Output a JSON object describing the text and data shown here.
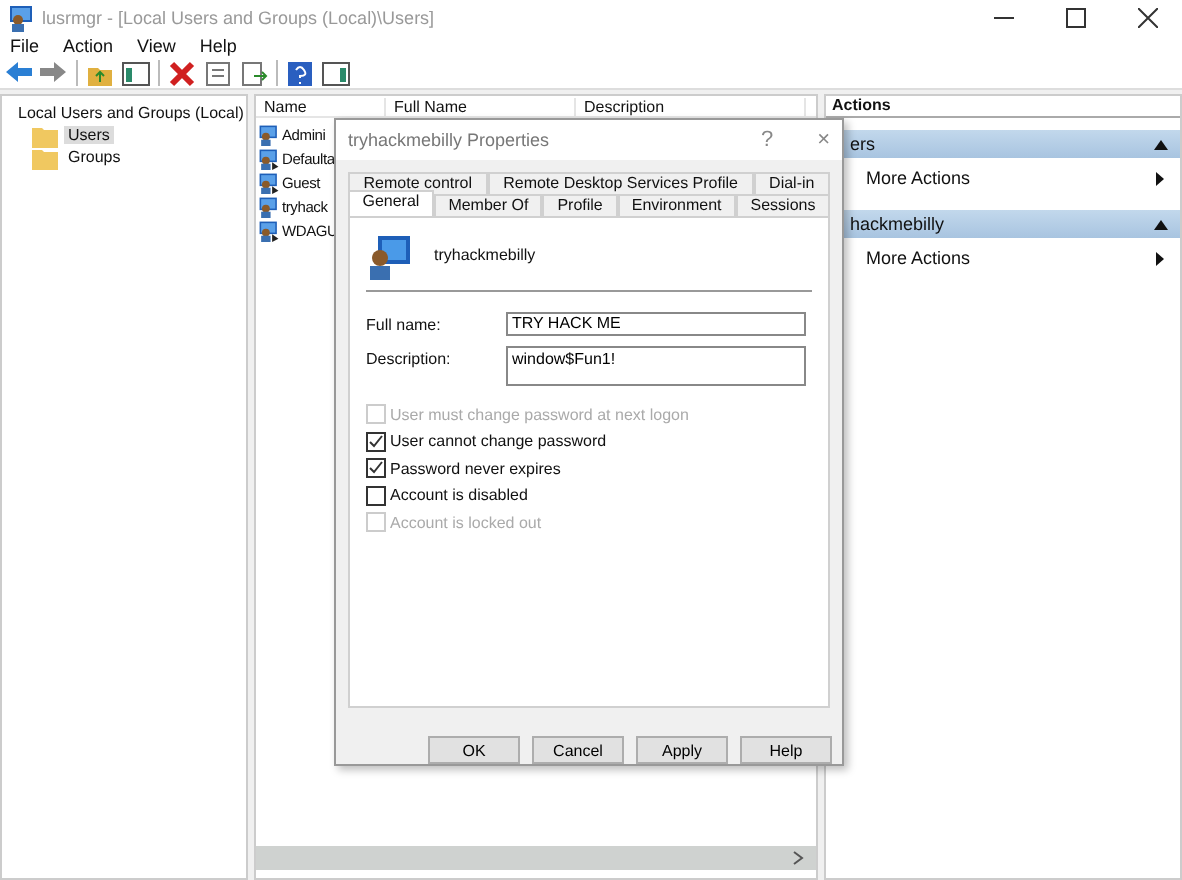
{
  "window": {
    "title": "lusrmgr - [Local Users and Groups (Local)\\Users]"
  },
  "menu": [
    "File",
    "Action",
    "View",
    "Help"
  ],
  "tree": [
    {
      "label": "Local Users and Groups (Local)",
      "selected": false,
      "children": [
        {
          "label": "Users",
          "selected": true
        },
        {
          "label": "Groups",
          "selected": false
        }
      ]
    }
  ],
  "list": {
    "columns": [
      "Name",
      "Full Name",
      "Description"
    ],
    "rows": [
      {
        "name": "Admini",
        "kind": "admin"
      },
      {
        "name": "Defaulta",
        "kind": "user"
      },
      {
        "name": "Guest",
        "kind": "user"
      },
      {
        "name": "tryhack",
        "kind": "admin"
      },
      {
        "name": "WDAGU",
        "kind": "user"
      }
    ]
  },
  "actions": {
    "title": "Actions",
    "sections": [
      {
        "header": "ers",
        "items": [
          "More Actions"
        ]
      },
      {
        "header": "hackmebilly",
        "items": [
          "More Actions"
        ]
      }
    ]
  },
  "dialog": {
    "title": "tryhackmebilly Properties",
    "help": "?",
    "close": "×",
    "tab_rows": [
      [
        {
          "label": "Remote control",
          "selected": false
        },
        {
          "label": "Remote Desktop Services Profile",
          "selected": false
        },
        {
          "label": "Dial-in",
          "selected": false
        }
      ],
      [
        {
          "label": "General",
          "selected": true
        },
        {
          "label": "Member Of",
          "selected": false
        },
        {
          "label": "Profile",
          "selected": false
        },
        {
          "label": "Environment",
          "selected": false
        },
        {
          "label": "Sessions",
          "selected": false
        }
      ]
    ],
    "username": "tryhackmebilly",
    "fields": [
      {
        "label": "Full name:",
        "value": "TRY HACK ME",
        "kind": "line"
      },
      {
        "label": "Description:",
        "value": "window$Fun1!",
        "kind": "box"
      }
    ],
    "checkboxes": [
      {
        "label": "User must change password at next logon",
        "checked": false,
        "disabled": true
      },
      {
        "label": "User cannot change password",
        "checked": true,
        "disabled": false
      },
      {
        "label": "Password never expires",
        "checked": true,
        "disabled": false
      },
      {
        "label": "Account is disabled",
        "checked": false,
        "disabled": false
      },
      {
        "label": "Account is locked out",
        "checked": false,
        "disabled": true
      }
    ],
    "buttons": [
      "OK",
      "Cancel",
      "Apply",
      "Help"
    ]
  }
}
